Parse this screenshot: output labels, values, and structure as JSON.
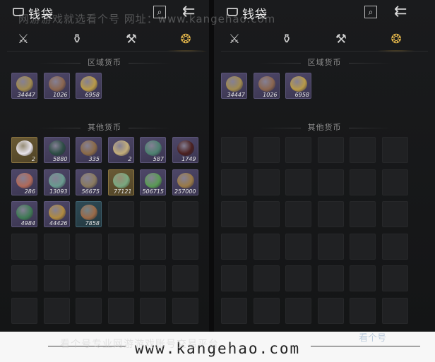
{
  "watermark": "网游游戏就选看个号  网址：www.kangehao.com",
  "left": {
    "title": "钱袋",
    "regional_label": "区域货币",
    "other_label": "其他货币",
    "regional_items": [
      {
        "name": "coin-a",
        "qty": "34447",
        "style": "item",
        "color": "#a08a50"
      },
      {
        "name": "coin-b",
        "qty": "1026",
        "style": "item",
        "color": "#8a6650"
      },
      {
        "name": "coin-c",
        "qty": "6958",
        "style": "item",
        "color": "#b89a48"
      }
    ],
    "other_items": [
      {
        "name": "pearl",
        "qty": "2",
        "style": "gold",
        "color": "#e6e2ea"
      },
      {
        "name": "herb",
        "qty": "5880",
        "style": "item",
        "color": "#2d4d45"
      },
      {
        "name": "tablet",
        "qty": "335",
        "style": "item",
        "color": "#8a6a48"
      },
      {
        "name": "slips",
        "qty": "2",
        "style": "item",
        "color": "#c2ad7a"
      },
      {
        "name": "jade-stone",
        "qty": "587",
        "style": "item",
        "color": "#4d8070"
      },
      {
        "name": "ember",
        "qty": "1749",
        "style": "item",
        "color": "#4a2020"
      },
      {
        "name": "ore",
        "qty": "286",
        "style": "item",
        "color": "#b06a5a"
      },
      {
        "name": "fish",
        "qty": "13093",
        "style": "item",
        "color": "#6a9a90"
      },
      {
        "name": "key",
        "qty": "56675",
        "style": "item",
        "color": "#8a7a60"
      },
      {
        "name": "jade-ring",
        "qty": "77121",
        "style": "gold",
        "color": "#7aa880"
      },
      {
        "name": "crystal",
        "qty": "506715",
        "style": "item",
        "color": "#5a9a55"
      },
      {
        "name": "bracelet",
        "qty": "257000",
        "style": "item",
        "color": "#9a7a48"
      },
      {
        "name": "emerald",
        "qty": "4984",
        "style": "item",
        "color": "#3f7a55"
      },
      {
        "name": "ingot",
        "qty": "44426",
        "style": "item",
        "color": "#b08a40"
      },
      {
        "name": "bronze-coin",
        "qty": "7858",
        "style": "teal",
        "color": "#9a6a48"
      }
    ]
  },
  "right": {
    "title": "钱袋",
    "regional_label": "区域货币",
    "other_label": "其他货币",
    "regional_items": [
      {
        "name": "coin-a",
        "qty": "34447",
        "style": "item",
        "color": "#a08a50"
      },
      {
        "name": "coin-b",
        "qty": "1026",
        "style": "item",
        "color": "#8a6650"
      },
      {
        "name": "coin-c",
        "qty": "6958",
        "style": "item",
        "color": "#b89a48"
      }
    ]
  },
  "icons": {
    "back": "⇇",
    "search": "⌕",
    "tabs": [
      "⚔",
      "⚱",
      "⚒",
      "❂"
    ]
  },
  "footer": {
    "url": "www.kangehao.com",
    "slogan": "看个号专业网游游戏账号交易平台",
    "brand": "看个号"
  }
}
